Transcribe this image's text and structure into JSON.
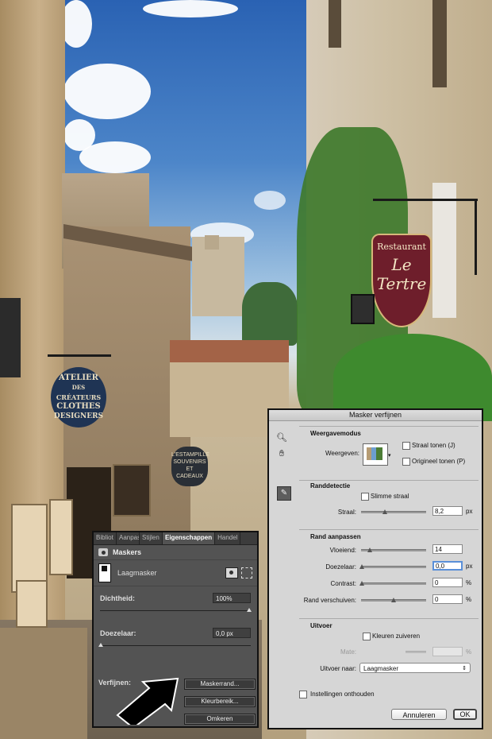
{
  "photo": {
    "atelier_sign": [
      "ATELIER",
      "DES",
      "CRÉATEURS",
      "CLOTHES",
      "DESIGNERS"
    ],
    "restaurant_sign": {
      "line1": "Restaurant",
      "line2": "Le",
      "line3": "Tertre"
    },
    "small_sign": [
      "L'ESTAMPILLE",
      "SOUVENIRS",
      "ET",
      "CADEAUX"
    ]
  },
  "properties_panel": {
    "tabs": [
      "Bibliot",
      "Aanpas",
      "Stijlen",
      "Eigenschappen",
      "Handel"
    ],
    "active_tab_index": 3,
    "section_title": "Maskers",
    "layer_mask_label": "Laagmasker",
    "density": {
      "label": "Dichtheid:",
      "value": "100%",
      "fraction": 1.0
    },
    "feather": {
      "label": "Doezelaar:",
      "value": "0,0 px",
      "fraction": 0.0
    },
    "refine_label": "Verfijnen:",
    "buttons": {
      "mask_edge": "Maskerrand...",
      "color_range": "Kleurbereik...",
      "invert": "Omkeren"
    }
  },
  "refine_dialog": {
    "title": "Masker verfijnen",
    "view_mode": {
      "title": "Weergavemodus",
      "view_label": "Weergeven:",
      "show_radius": "Straal tonen (J)",
      "show_original": "Origineel tonen (P)"
    },
    "edge_detection": {
      "title": "Randdetectie",
      "smart_radius": "Slimme straal",
      "radius_label": "Straal:",
      "radius_value": "8,2",
      "radius_unit": "px",
      "radius_fraction": 0.15
    },
    "adjust_edge": {
      "title": "Rand aanpassen",
      "smooth": {
        "label": "Vloeiend:",
        "value": "14",
        "unit": "",
        "fraction": 0.14
      },
      "feather": {
        "label": "Doezelaar:",
        "value": "0,0",
        "unit": "px",
        "fraction": 0.0
      },
      "contrast": {
        "label": "Contrast:",
        "value": "0",
        "unit": "%",
        "fraction": 0.0
      },
      "shift_edge": {
        "label": "Rand verschuiven:",
        "value": "0",
        "unit": "%",
        "fraction": 0.5
      }
    },
    "output": {
      "title": "Uitvoer",
      "decontaminate": "Kleuren zuiveren",
      "amount_label": "Mate:",
      "amount_unit": "%",
      "output_to_label": "Uitvoer naar:",
      "output_to_value": "Laagmasker"
    },
    "remember_settings": "Instellingen onthouden",
    "cancel": "Annuleren",
    "ok": "OK"
  }
}
